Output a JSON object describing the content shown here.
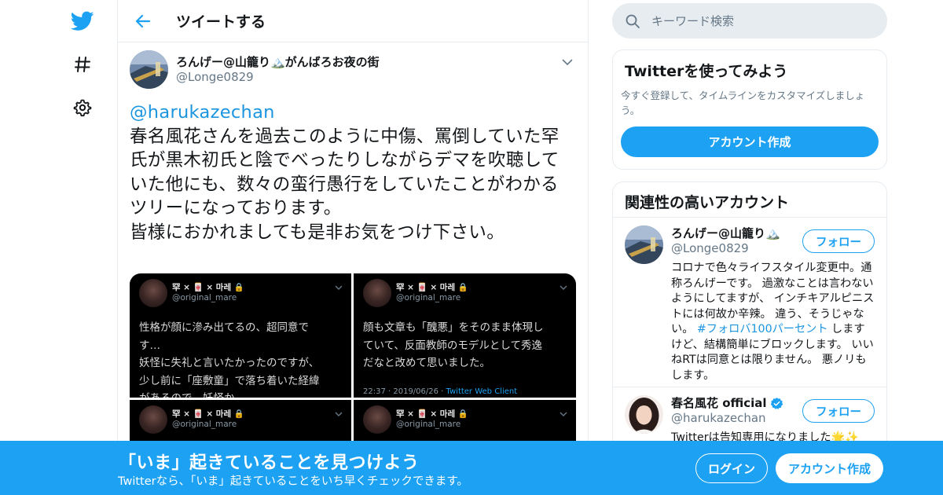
{
  "colors": {
    "accent": "#1da1f2",
    "link": "#1b95e0",
    "muted": "#657786",
    "border": "#e6ecf0"
  },
  "nav": {
    "logo_icon": "twitter-bird-icon",
    "explore_icon": "hashtag-icon",
    "settings_icon": "gear-icon"
  },
  "header": {
    "back_icon": "arrow-left-icon",
    "title": "ツイートする"
  },
  "tweet": {
    "author_name": "ろんげー@山籠り🏔️がんばろお夜の街",
    "author_handle": "@Longe0829",
    "mention": "@harukazechan",
    "lines": [
      "春名風花さんを過去このように中傷、罵倒していた罕",
      "氏が黒木初氏と陰でべったりしながらデマを吹聴して",
      "いた他にも、数々の蛮行愚行をしていたことがわかる",
      "ツリーになっております。",
      "皆様におかれましても是非お気をつけ下さい。"
    ],
    "media": [
      {
        "name": "罕 × 🀄 × 마레 🔒",
        "handle": "@original_mare",
        "lines": [
          "性格が顔に滲み出てるの、超同意で",
          "す…",
          "妖怪に失礼と言いたかったのですが、",
          "少し前に「座敷童」で落ち着いた経緯",
          "があるので…妖怪か"
        ],
        "footer_time": "",
        "footer_client": ""
      },
      {
        "name": "罕 × 🀄 × 마레 🔒",
        "handle": "@original_mare",
        "lines": [
          "顔も文章も「醜悪」をそのまま体現し",
          "ていて、反面教師のモデルとして秀逸",
          "だなと改めて思いました。"
        ],
        "footer_time": "22:37 · 2019/06/26 · ",
        "footer_client": "Twitter Web Client"
      },
      {
        "name": "罕 × 🀄 × 마레 🔒",
        "handle": "@original_mare",
        "lines": [],
        "footer_time": "",
        "footer_client": ""
      },
      {
        "name": "罕 × 🀄 × 마레 🔒",
        "handle": "@original_mare",
        "lines": [],
        "footer_time": "",
        "footer_client": ""
      }
    ]
  },
  "search": {
    "placeholder": "キーワード検索"
  },
  "signup_card": {
    "title": "Twitterを使ってみよう",
    "description": "今すぐ登録して、タイムラインをカスタマイズしましょう。",
    "button": "アカウント作成"
  },
  "related": {
    "title": "関連性の高いアカウント",
    "follow_label": "フォロー",
    "accounts": [
      {
        "name": "ろんげー@山籠り🏔️",
        "handle": "@Longe0829",
        "bio_before": "コロナで色々ライフスタイル変更中。通称ろんげーです。 過激なことは言わないようにしてますが、 インチキアルピニストには何故か辛辣。 違う、そうじゃない。 ",
        "bio_tag": "#フォロバ100パーセント",
        "bio_after": " しますけど、結構簡単にブロックします。 いいねRTは同意とは限りません。 悪ノリもします。",
        "verified": false
      },
      {
        "name": "春名風花 official",
        "handle": "@harukazechan",
        "bio_before": "Twitterは告知専用になりました🌟✨",
        "bio_tag": "",
        "bio_after": "",
        "verified": true
      }
    ]
  },
  "banner": {
    "title": "「いま」起きていることを見つけよう",
    "subtitle": "Twitterなら、「いま」起きていることをいち早くチェックできます。",
    "login": "ログイン",
    "signup": "アカウント作成"
  }
}
